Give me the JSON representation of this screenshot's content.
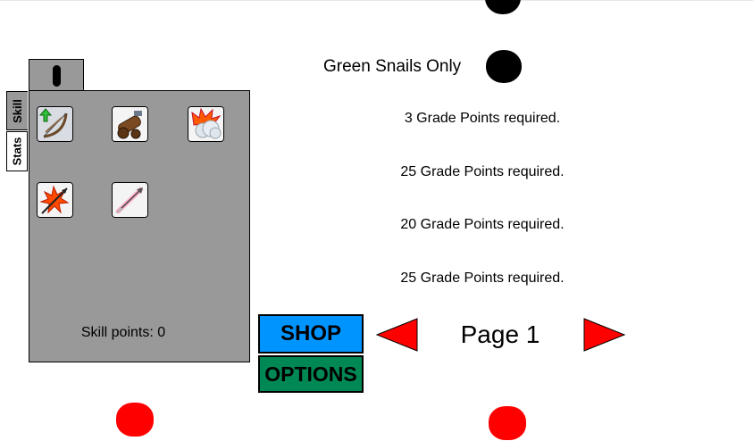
{
  "skill_panel": {
    "tabs": [
      {
        "label": "Skill"
      },
      {
        "label": "Stats"
      }
    ],
    "skills": [
      {
        "icon": "bow-upgrade-icon"
      },
      {
        "icon": "cannon-icon"
      },
      {
        "icon": "explosion-cloud-icon"
      },
      {
        "icon": "fire-arrow-icon"
      },
      {
        "icon": "pink-arrow-icon"
      }
    ],
    "skill_points_label": "Skill points: 0"
  },
  "filter": {
    "label": "Green Snails Only"
  },
  "requirements": [
    "3 Grade Points required.",
    "25 Grade Points required.",
    "20 Grade Points required.",
    "25 Grade Points required."
  ],
  "buttons": {
    "shop": "SHOP",
    "options": "OPTIONS"
  },
  "pagination": {
    "label": "Page 1"
  },
  "colors": {
    "shop": "#0094ff",
    "options": "#008854",
    "arrow": "#ff0000",
    "panel": "#999999"
  }
}
